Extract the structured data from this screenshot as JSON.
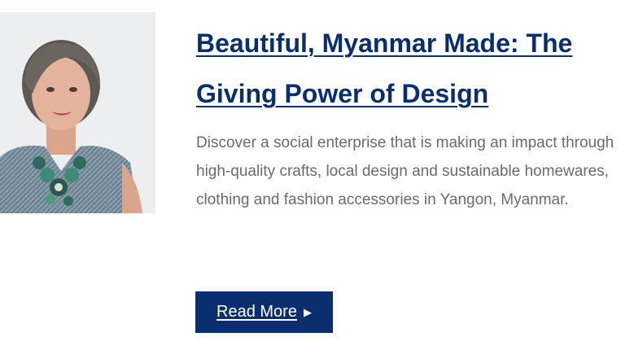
{
  "article": {
    "title": "Beautiful, Myanmar Made: The Giving Power of Design",
    "description": "Discover a social enterprise that is making an impact through high-quality crafts, local design and sustainable homewares, clothing and fashion accessories in Yangon, Myanmar.",
    "read_more_label": "Read More",
    "read_more_icon": "caret-right-icon",
    "photo_alt": "Portrait of woman with short grey hair wearing a green statement necklace"
  },
  "colors": {
    "accent": "#0b2f6e",
    "body_text": "#6a6a6a",
    "background": "#ffffff"
  }
}
